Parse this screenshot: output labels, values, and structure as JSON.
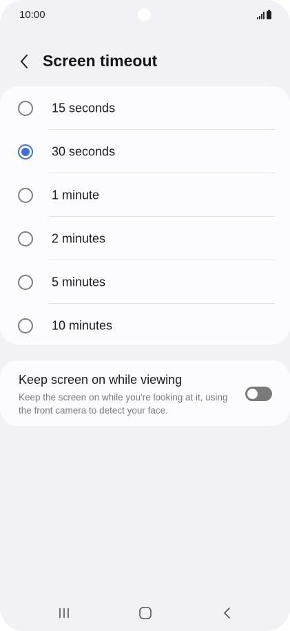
{
  "status_bar": {
    "time": "10:00",
    "icons": [
      "front-camera-icon",
      "signal-icon",
      "battery-icon"
    ]
  },
  "header": {
    "back_icon": "chevron-left-icon",
    "title": "Screen timeout"
  },
  "timeout_options": [
    {
      "label": "15 seconds",
      "selected": false
    },
    {
      "label": "30 seconds",
      "selected": true
    },
    {
      "label": "1 minute",
      "selected": false
    },
    {
      "label": "2 minutes",
      "selected": false
    },
    {
      "label": "5 minutes",
      "selected": false
    },
    {
      "label": "10 minutes",
      "selected": false
    }
  ],
  "keep_screen_on": {
    "title": "Keep screen on while viewing",
    "description": "Keep the screen on while you're looking at it, using the front camera to detect your face.",
    "enabled": false
  },
  "nav_bar": {
    "buttons": [
      "recent-apps-icon",
      "home-icon",
      "back-icon"
    ]
  },
  "colors": {
    "background": "#f2f2f6",
    "card": "#fcfcfe",
    "accent": "#3e6fe0",
    "toggle_off": "#7a7a7a"
  }
}
